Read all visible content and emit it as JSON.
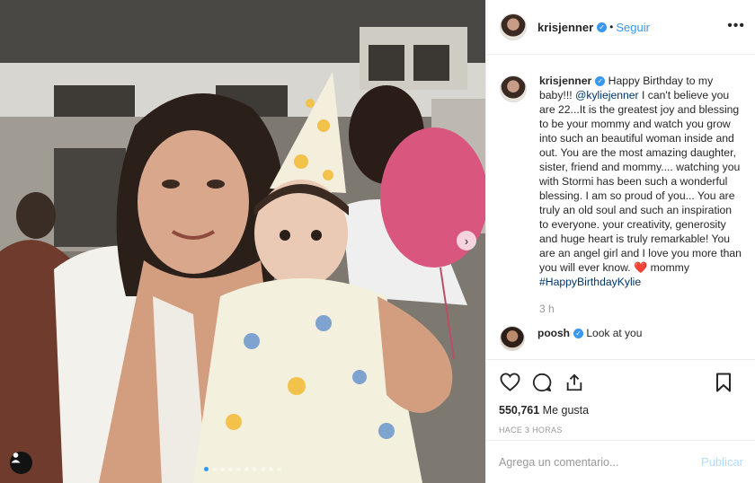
{
  "post": {
    "username": "krisjenner",
    "follow_label": "Seguir",
    "separator": "•",
    "more_label": "•••"
  },
  "caption": {
    "username": "krisjenner",
    "text_intro": "Happy Birthday to my baby!!! ",
    "mention": "@kyliejenner",
    "text_body": " I can't believe you are 22...It is the greatest joy and blessing to be your mommy and watch you grow into such an beautiful woman inside and out. You are the most amazing daughter, sister, friend and mommy.... watching you with Stormi has been such a wonderful blessing. I am so proud of you... You are truly an old soul and such an inspiration to everyone. your creativity, generosity and huge heart is truly remarkable! You are an angel girl and I love you more than you will ever know. ",
    "heart_emoji": "❤️",
    "text_end": "mommy ",
    "hashtag": "#HappyBirthdayKylie",
    "time": "3 h"
  },
  "comment": {
    "username": "poosh",
    "text": "Look at you"
  },
  "stats": {
    "likes_count": "550,761",
    "likes_label": "Me gusta",
    "posted_ago": "HACE 3 HORAS"
  },
  "add_comment": {
    "placeholder": "Agrega un comentario...",
    "post_label": "Publicar"
  },
  "carousel": {
    "total": 10,
    "active": 1,
    "active_color": "#2a9af4"
  },
  "colors": {
    "link": "#3897f0",
    "mention": "#003569",
    "heart": "#e8333f",
    "balloon": "#d9567f"
  },
  "icons": [
    "heart-icon",
    "comment-icon",
    "share-icon",
    "bookmark-icon",
    "user-tag-icon",
    "chevron-right-icon",
    "verified-icon",
    "more-icon"
  ]
}
